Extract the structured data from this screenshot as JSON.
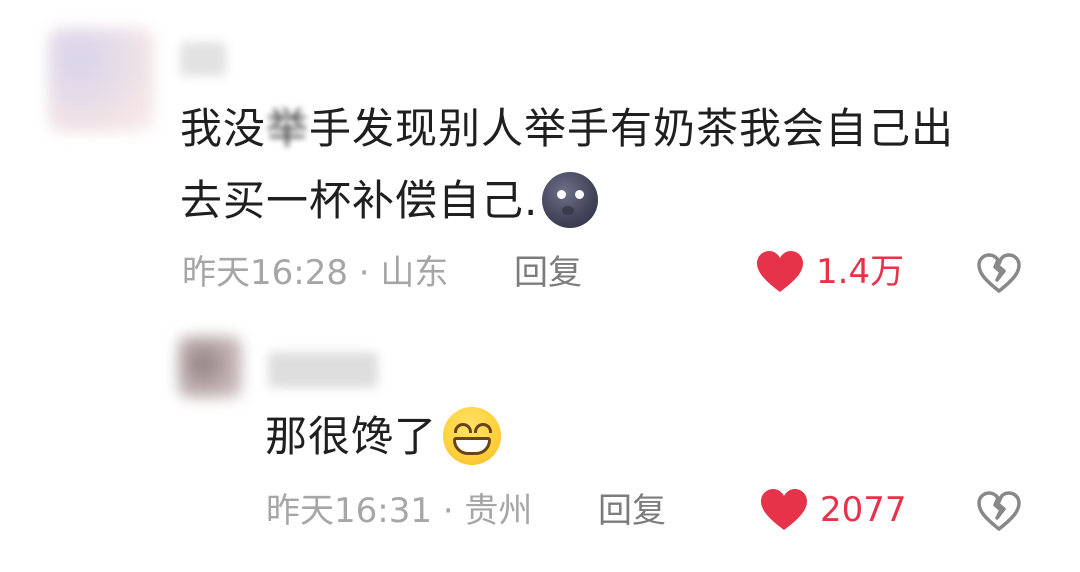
{
  "comment": {
    "text_line1_part1": "我没",
    "text_line1_hidden": "举",
    "text_line1_part2": "手发现别人举手有奶茶我会自己出",
    "text_line2": "去买一杯补偿自己.",
    "emoji": "new-moon-face-icon",
    "time": "昨天16:28",
    "separator": "·",
    "location": "山东",
    "reply_label": "回复",
    "like_count": "1.4万",
    "like_color": "#e6334a"
  },
  "reply": {
    "text": "那很馋了",
    "emoji": "grinning-face-icon",
    "time": "昨天16:31",
    "separator": "·",
    "location": "贵州",
    "reply_label": "回复",
    "like_count": "2077",
    "like_color": "#e6334a"
  }
}
